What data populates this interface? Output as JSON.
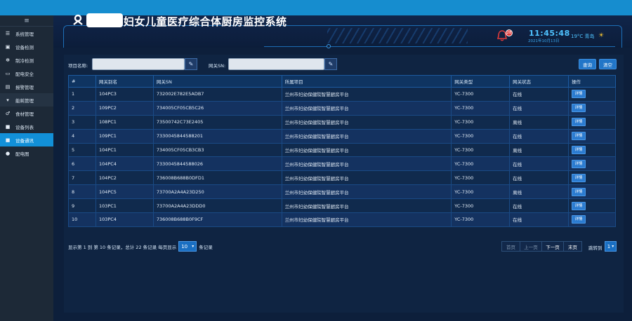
{
  "sidebar": {
    "toggle": "≡",
    "items": [
      {
        "label": "系统管理",
        "icon": "list-icon"
      },
      {
        "label": "设备检测",
        "icon": "device-icon"
      },
      {
        "label": "制冷检测",
        "icon": "snowflake-icon"
      },
      {
        "label": "配电安全",
        "icon": "monitor-icon"
      },
      {
        "label": "报警管理",
        "icon": "alarm-icon"
      },
      {
        "label": "能耗管理",
        "icon": "chevron-down-icon"
      },
      {
        "label": "食材管理",
        "icon": "food-icon"
      },
      {
        "label": "设备列表",
        "icon": "square-icon"
      },
      {
        "label": "设备通讯",
        "icon": "square-icon"
      },
      {
        "label": "配电图",
        "icon": "circle-icon"
      }
    ]
  },
  "header": {
    "title": "妇女儿童医疗综合体厨房监控系统",
    "alarm_count": "28",
    "time": "11:45:48",
    "date": "2021年10月13日",
    "weather": "19°C 青岛"
  },
  "filters": {
    "project_label": "项目名称:",
    "project_value": "",
    "gateway_label": "网关SN:",
    "gateway_value": "",
    "search_label": "查询",
    "clear_label": "清空"
  },
  "table": {
    "headers": [
      "#",
      "网关别名",
      "网关SN",
      "所属项目",
      "网关类型",
      "网关状态",
      "操作"
    ],
    "detail_label": "详情",
    "rows": [
      {
        "no": "1",
        "alias": "104PC3",
        "sn": "732002E782E5ADB7",
        "project": "兰州市妇幼保健院智慧厨房平台",
        "type": "YC-7300",
        "status": "在线",
        "online": true
      },
      {
        "no": "2",
        "alias": "109PC2",
        "sn": "734005CF05CB5C26",
        "project": "兰州市妇幼保健院智慧厨房平台",
        "type": "YC-7300",
        "status": "在线",
        "online": true
      },
      {
        "no": "3",
        "alias": "108PC1",
        "sn": "73500742C73E2405",
        "project": "兰州市妇幼保健院智慧厨房平台",
        "type": "YC-7300",
        "status": "离线",
        "online": false
      },
      {
        "no": "4",
        "alias": "109PC1",
        "sn": "7330045844588201",
        "project": "兰州市妇幼保健院智慧厨房平台",
        "type": "YC-7300",
        "status": "在线",
        "online": true
      },
      {
        "no": "5",
        "alias": "104PC1",
        "sn": "734005CF05CB3CB3",
        "project": "兰州市妇幼保健院智慧厨房平台",
        "type": "YC-7300",
        "status": "离线",
        "online": false
      },
      {
        "no": "6",
        "alias": "104PC4",
        "sn": "7330045844588026",
        "project": "兰州市妇幼保健院智慧厨房平台",
        "type": "YC-7300",
        "status": "在线",
        "online": true
      },
      {
        "no": "7",
        "alias": "104PC2",
        "sn": "736008B688B0DFD1",
        "project": "兰州市妇幼保健院智慧厨房平台",
        "type": "YC-7300",
        "status": "在线",
        "online": true
      },
      {
        "no": "8",
        "alias": "104PC5",
        "sn": "73700A2A4A23D250",
        "project": "兰州市妇幼保健院智慧厨房平台",
        "type": "YC-7300",
        "status": "离线",
        "online": false
      },
      {
        "no": "9",
        "alias": "103PC1",
        "sn": "73700A2A4A23DDD0",
        "project": "兰州市妇幼保健院智慧厨房平台",
        "type": "YC-7300",
        "status": "在线",
        "online": true
      },
      {
        "no": "10",
        "alias": "103PC4",
        "sn": "736008B688B0F9CF",
        "project": "兰州市妇幼保健院智慧厨房平台",
        "type": "YC-7300",
        "status": "在线",
        "online": true
      }
    ]
  },
  "pagination": {
    "info_prefix": "显示第 1 到 第 10 条记录，总计 22 条记录 每页显示",
    "page_size": "10",
    "info_suffix": "条记录",
    "first": "首页",
    "prev": "上一页",
    "next": "下一页",
    "last": "末页",
    "jump_label": "跳转到",
    "jump_value": "1"
  },
  "colors": {
    "accent": "#1290d8",
    "online": "#4be18a",
    "offline": "#ff3b3b"
  }
}
